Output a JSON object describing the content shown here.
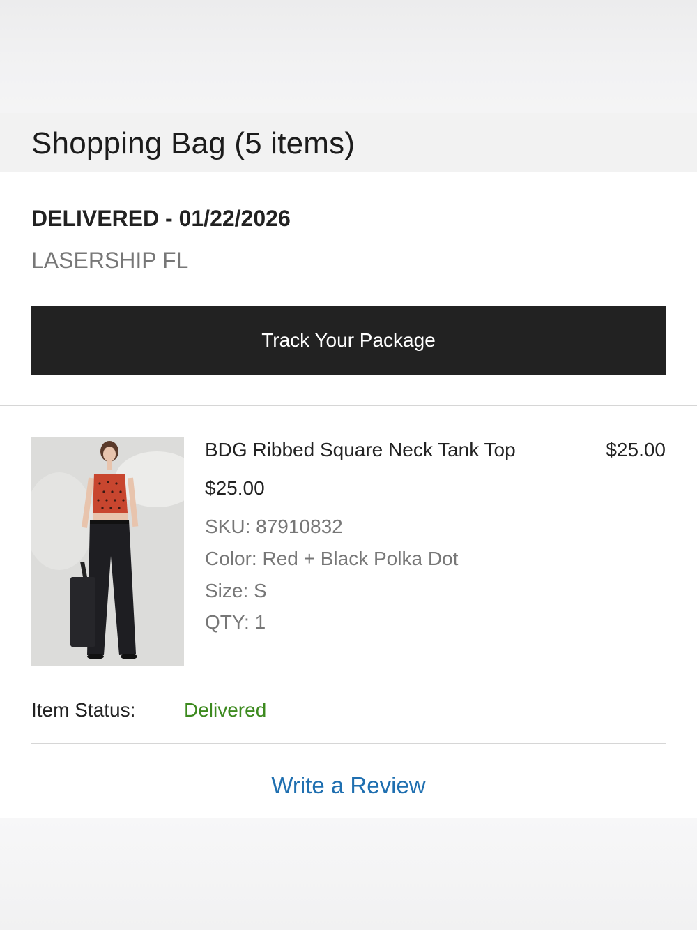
{
  "header": {
    "title": "Shopping Bag (5 items)"
  },
  "shipment": {
    "status": "DELIVERED - 01/22/2026",
    "carrier": "LASERSHIP FL",
    "track_button_label": "Track Your Package"
  },
  "item": {
    "name": "BDG Ribbed Square Neck Tank Top",
    "line_total": "$25.00",
    "unit_price": "$25.00",
    "sku": "SKU: 87910832",
    "color": "Color: Red + Black Polka Dot",
    "size": "Size: S",
    "qty": "QTY: 1",
    "status_label": "Item Status:",
    "status_value": "Delivered",
    "review_link": "Write a Review"
  },
  "colors": {
    "button_bg": "#222222",
    "status_green": "#3d8a1f",
    "link_blue": "#1f6fb0"
  }
}
